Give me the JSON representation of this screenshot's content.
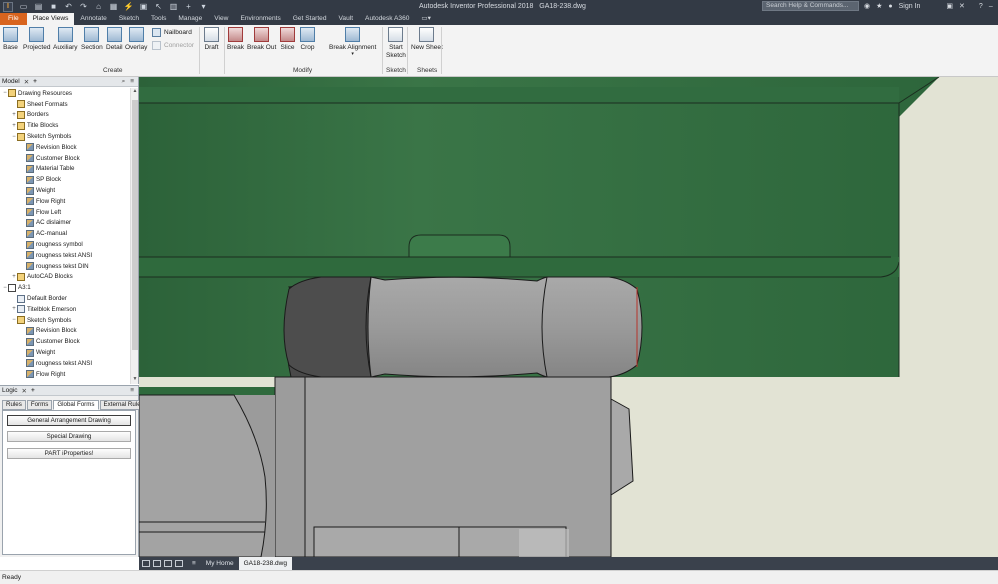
{
  "window": {
    "title": "Autodesk Inventor Professional 2018",
    "filename": "GA18-238.dwg",
    "search_placeholder": "Search Help & Commands...",
    "sign_in": "Sign In"
  },
  "tabs": [
    "File",
    "Place Views",
    "Annotate",
    "Sketch",
    "Tools",
    "Manage",
    "View",
    "Environments",
    "Get Started",
    "Vault",
    "Autodesk A360"
  ],
  "ribbon": {
    "create": {
      "base": "Base",
      "projected": "Projected",
      "auxiliary": "Auxiliary",
      "section": "Section",
      "detail": "Detail",
      "overlay": "Overlay",
      "nailboard": "Nailboard",
      "connector": "Connector",
      "label": "Create"
    },
    "modify": {
      "draft": "Draft",
      "break": "Break",
      "break_out": "Break Out",
      "slice": "Slice",
      "crop": "Crop",
      "break_alignment": "Break Alignment",
      "label": "Modify"
    },
    "sketch": {
      "start_sketch_1": "Start",
      "start_sketch_2": "Sketch",
      "label": "Sketch"
    },
    "sheets": {
      "new_sheet": "New Sheet",
      "label": "Sheets"
    }
  },
  "model_panel": {
    "title": "Model",
    "tree": [
      {
        "label": "Drawing Resources",
        "indent": 0,
        "twisty": "−",
        "icon": "folder"
      },
      {
        "label": "Sheet Formats",
        "indent": 1,
        "twisty": "",
        "icon": "folder"
      },
      {
        "label": "Borders",
        "indent": 1,
        "twisty": "+",
        "icon": "folder"
      },
      {
        "label": "Title Blocks",
        "indent": 1,
        "twisty": "+",
        "icon": "folder"
      },
      {
        "label": "Sketch Symbols",
        "indent": 1,
        "twisty": "−",
        "icon": "folder"
      },
      {
        "label": "Revision Block",
        "indent": 2,
        "twisty": "",
        "icon": "sym"
      },
      {
        "label": "Customer Block",
        "indent": 2,
        "twisty": "",
        "icon": "sym"
      },
      {
        "label": "Material Table",
        "indent": 2,
        "twisty": "",
        "icon": "sym"
      },
      {
        "label": "SP Block",
        "indent": 2,
        "twisty": "",
        "icon": "sym"
      },
      {
        "label": "Weight",
        "indent": 2,
        "twisty": "",
        "icon": "sym"
      },
      {
        "label": "Flow Right",
        "indent": 2,
        "twisty": "",
        "icon": "sym"
      },
      {
        "label": "Flow Left",
        "indent": 2,
        "twisty": "",
        "icon": "sym"
      },
      {
        "label": "AC dislaimer",
        "indent": 2,
        "twisty": "",
        "icon": "sym"
      },
      {
        "label": "AC-manual",
        "indent": 2,
        "twisty": "",
        "icon": "sym"
      },
      {
        "label": "rougness symbol",
        "indent": 2,
        "twisty": "",
        "icon": "sym"
      },
      {
        "label": "rougness tekst ANSI",
        "indent": 2,
        "twisty": "",
        "icon": "sym"
      },
      {
        "label": "rougness tekst DIN",
        "indent": 2,
        "twisty": "",
        "icon": "sym"
      },
      {
        "label": "AutoCAD Blocks",
        "indent": 1,
        "twisty": "+",
        "icon": "folder"
      },
      {
        "label": "A3:1",
        "indent": 0,
        "twisty": "−",
        "icon": "sheet"
      },
      {
        "label": "Default Border",
        "indent": 1,
        "twisty": "",
        "icon": "doc"
      },
      {
        "label": "Titelblok Emerson",
        "indent": 1,
        "twisty": "+",
        "icon": "doc"
      },
      {
        "label": "Sketch Symbols",
        "indent": 1,
        "twisty": "−",
        "icon": "folder"
      },
      {
        "label": "Revision Block",
        "indent": 2,
        "twisty": "",
        "icon": "sym"
      },
      {
        "label": "Customer Block",
        "indent": 2,
        "twisty": "",
        "icon": "sym"
      },
      {
        "label": "Weight",
        "indent": 2,
        "twisty": "",
        "icon": "sym"
      },
      {
        "label": "rougness tekst ANSI",
        "indent": 2,
        "twisty": "",
        "icon": "sym"
      },
      {
        "label": "Flow Right",
        "indent": 2,
        "twisty": "",
        "icon": "sym"
      }
    ]
  },
  "logic_panel": {
    "title": "Logic",
    "tabs": [
      "Rules",
      "Forms",
      "Global Forms",
      "External Rules"
    ],
    "active_tab": "Global Forms",
    "buttons": [
      "General Arrangement Drawing",
      "Special Drawing",
      "PART iProperties!"
    ]
  },
  "doc_tabs": [
    "My Home",
    "GA18-238.dwg"
  ],
  "status": "Ready",
  "colors": {
    "file_tab": "#d8641e",
    "title_bar": "#333a45",
    "green_part": "#2f6a3f",
    "canvas_bg": "#e2e3d4"
  }
}
